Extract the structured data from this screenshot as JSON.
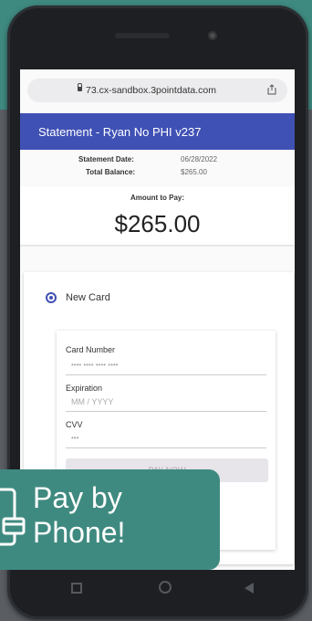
{
  "browser": {
    "url": "73.cx-sandbox.3pointdata.com"
  },
  "header": {
    "title": "Statement - Ryan No PHI v237"
  },
  "summary": {
    "statement_date_label": "Statement Date:",
    "statement_date": "06/28/2022",
    "total_balance_label": "Total Balance:",
    "total_balance": "$265.00"
  },
  "amount": {
    "label": "Amount to Pay:",
    "value": "$265.00"
  },
  "payment": {
    "option_label": "New Card",
    "card_number_label": "Card Number",
    "card_number_placeholder": "•••• •••• •••• ••••",
    "expiration_label": "Expiration",
    "expiration_placeholder": "MM / YYYY",
    "cvv_label": "CVV",
    "cvv_placeholder": "•••",
    "pay_button": "PAY NOW"
  },
  "badge": {
    "line1": "Pay by",
    "line2": "Phone!"
  },
  "colors": {
    "header": "#4051b5",
    "badge": "#3f8a80"
  }
}
